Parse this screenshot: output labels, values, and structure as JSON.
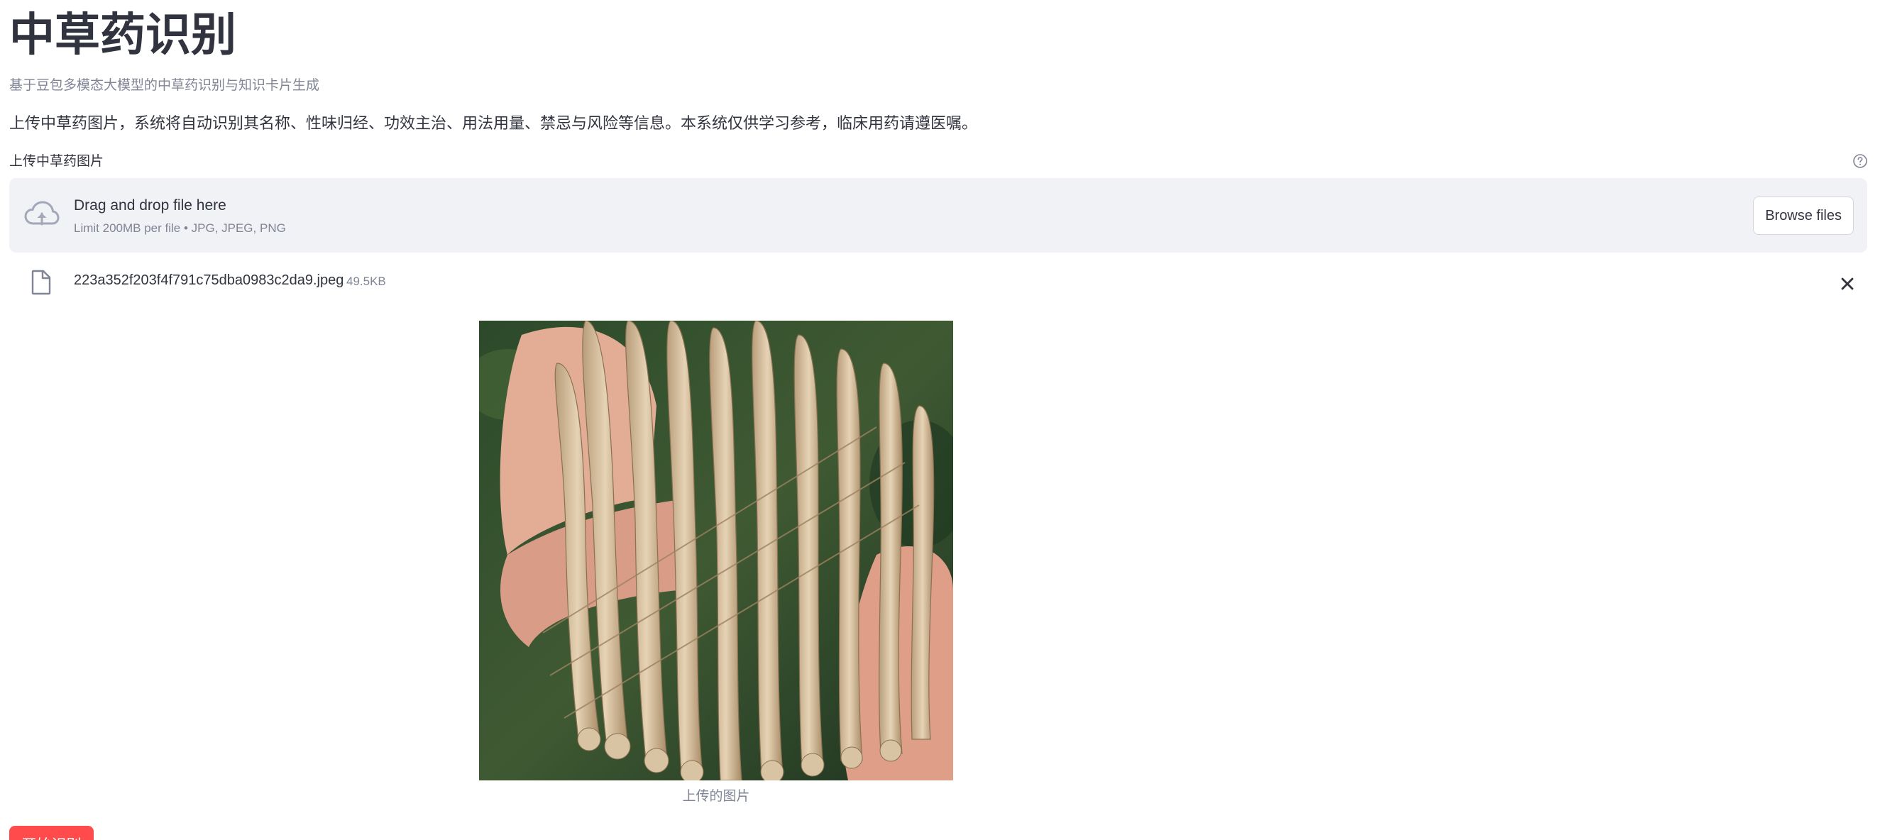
{
  "header": {
    "title": "中草药识别",
    "subtitle": "基于豆包多模态大模型的中草药识别与知识卡片生成",
    "description": "上传中草药图片，系统将自动识别其名称、性味归经、功效主治、用法用量、禁忌与风险等信息。本系统仅供学习参考，临床用药请遵医嘱。"
  },
  "uploader": {
    "label": "上传中草药图片",
    "help_icon": "question-circle-icon",
    "drop_title": "Drag and drop file here",
    "drop_limit": "Limit 200MB per file • JPG, JPEG, PNG",
    "browse_label": "Browse files",
    "cloud_icon": "cloud-upload-icon"
  },
  "file": {
    "name": "223a352f203f4f791c75dba0983c2da9.jpeg",
    "size": "49.5KB",
    "icon": "file-icon",
    "remove_icon": "close-icon"
  },
  "preview": {
    "caption": "上传的图片"
  },
  "actions": {
    "start_label": "开始识别"
  },
  "colors": {
    "primary": "#ff4b4b",
    "text": "#31333f",
    "muted": "#808495",
    "dropzone_bg": "#f0f2f6"
  }
}
